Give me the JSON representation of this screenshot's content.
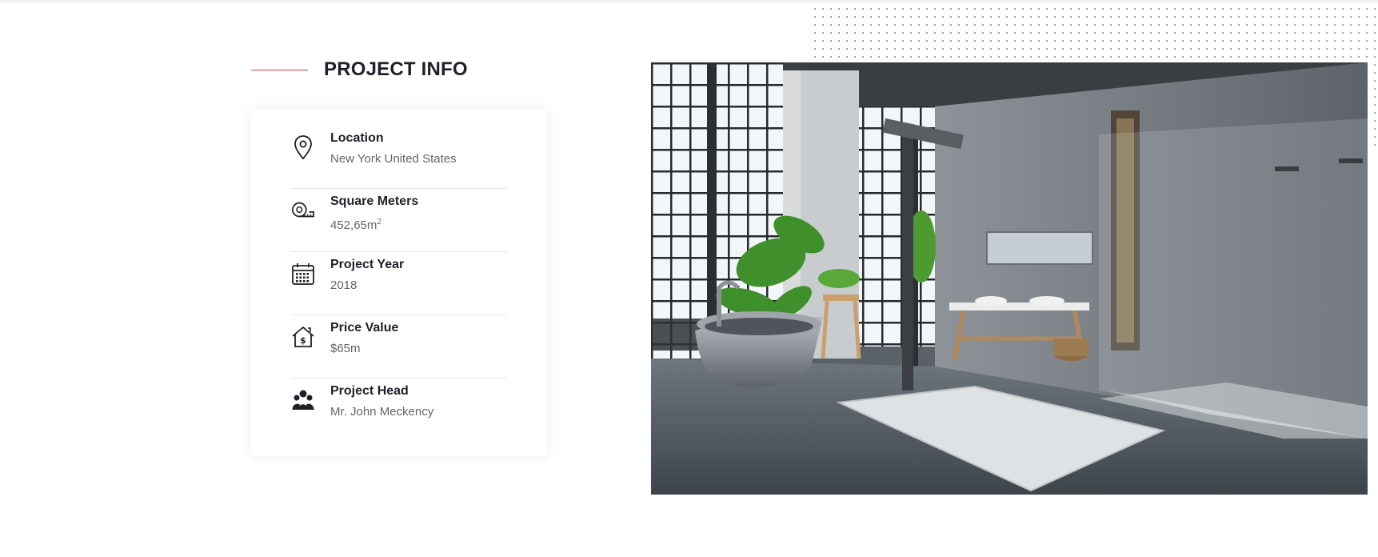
{
  "section": {
    "title": "PROJECT INFO",
    "accent_color": "#e13b3b"
  },
  "project_info": [
    {
      "icon": "location-pin-icon",
      "label": "Location",
      "value": "New York United States"
    },
    {
      "icon": "tape-measure-icon",
      "label": "Square Meters",
      "value": "452,65m",
      "value_sup": "2"
    },
    {
      "icon": "calendar-icon",
      "label": "Project Year",
      "value": "2018"
    },
    {
      "icon": "house-dollar-icon",
      "label": "Price Value",
      "value": "$65m"
    },
    {
      "icon": "team-icon",
      "label": "Project Head",
      "value": "Mr. John Meckency"
    }
  ],
  "image": {
    "subject": "industrial loft bathroom"
  }
}
